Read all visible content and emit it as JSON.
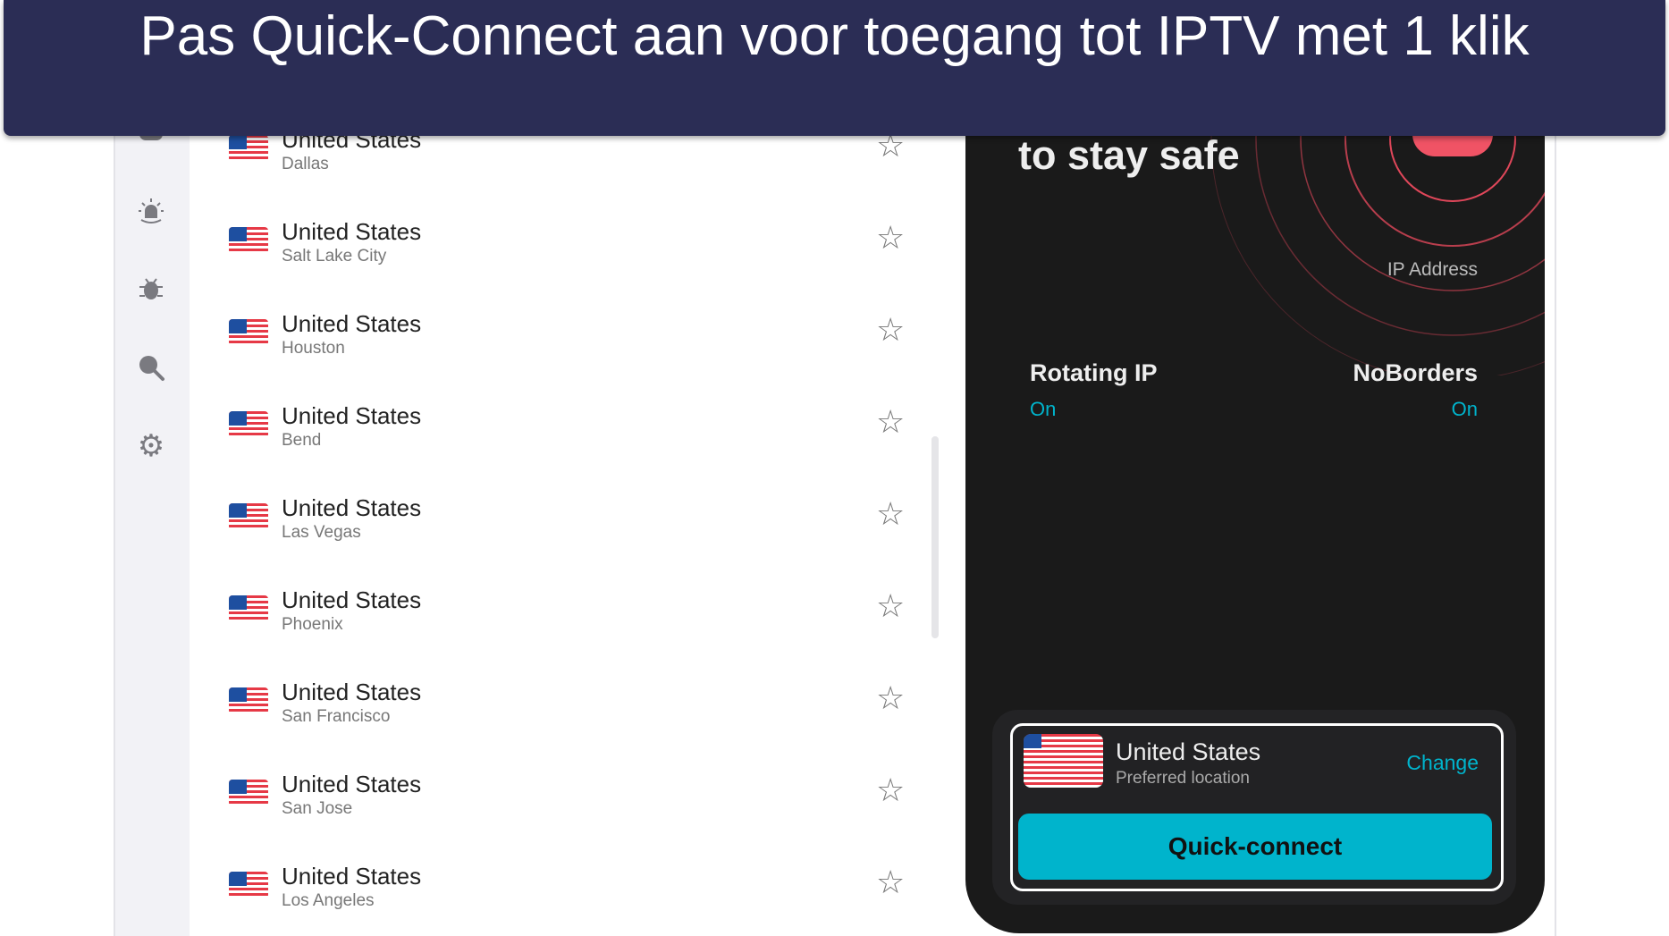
{
  "banner": {
    "title": "Pas Quick-Connect aan voor toegang tot IPTV met 1 klik"
  },
  "sidebar": {
    "icons": [
      "alarm-icon",
      "bug-icon",
      "search-icon",
      "gear-icon"
    ]
  },
  "locations": [
    {
      "country": "United States",
      "city": "Dallas"
    },
    {
      "country": "United States",
      "city": "Salt Lake City"
    },
    {
      "country": "United States",
      "city": "Houston"
    },
    {
      "country": "United States",
      "city": "Bend"
    },
    {
      "country": "United States",
      "city": "Las Vegas"
    },
    {
      "country": "United States",
      "city": "Phoenix"
    },
    {
      "country": "United States",
      "city": "San Francisco"
    },
    {
      "country": "United States",
      "city": "San Jose"
    },
    {
      "country": "United States",
      "city": "Los Angeles"
    }
  ],
  "panel": {
    "headline": "to stay safe",
    "ip_label": "IP Address",
    "rotating_ip": {
      "label": "Rotating IP",
      "value": "On"
    },
    "noborders": {
      "label": "NoBorders",
      "value": "On"
    },
    "location": {
      "country": "United States",
      "sub": "Preferred location",
      "change": "Change"
    },
    "quick_connect": "Quick-connect"
  },
  "colors": {
    "banner": "#2b2d55",
    "accent": "#00b4cc",
    "panel": "#1a1a1a",
    "ring": "#e0475a"
  }
}
